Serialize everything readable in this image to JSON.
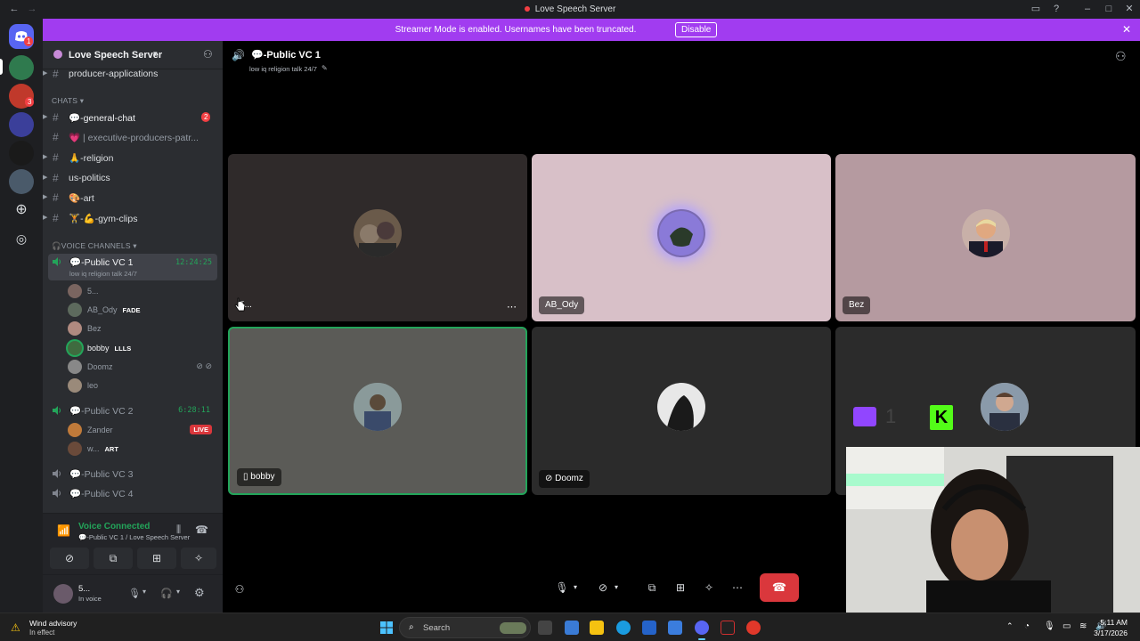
{
  "window": {
    "title": "Love Speech Server"
  },
  "banner": {
    "message": "Streamer Mode is enabled. Usernames have been truncated.",
    "button": "Disable"
  },
  "rail": {
    "badges": [
      "1",
      "3"
    ]
  },
  "sidebar": {
    "server_name": "Love Speech Server",
    "channels_top": [
      {
        "label": "producer-applications"
      }
    ],
    "chats_category": "CHATS",
    "chats": [
      {
        "label": "💬-general-chat",
        "badge": "2"
      },
      {
        "label": "💗 | executive-producers-patr..."
      },
      {
        "label": "🙏-religion"
      },
      {
        "label": "us-politics"
      },
      {
        "label": "🎨-art"
      },
      {
        "label": "🏋-💪-gym-clips"
      }
    ],
    "voice_category": "VOICE CHANNELS",
    "voice_channels": [
      {
        "label": "💬-Public VC 1",
        "timer": "12:24:25",
        "status": "low iq religion talk 24/7"
      },
      {
        "label": "💬-Public VC 2",
        "timer": "6:28:11"
      },
      {
        "label": "💬-Public VC 3"
      },
      {
        "label": "💬-Public VC 4"
      }
    ],
    "vc1_users": [
      {
        "name": "5..."
      },
      {
        "name": "AB_Ody",
        "tag": "FADE"
      },
      {
        "name": "Bez"
      },
      {
        "name": "bobby",
        "tag": "LLLS"
      },
      {
        "name": "Doomz"
      },
      {
        "name": "leo"
      }
    ],
    "vc2_users": [
      {
        "name": "Zander",
        "live": "LIVE"
      },
      {
        "name": "w...",
        "tag": "ART"
      }
    ]
  },
  "voice_panel": {
    "status": "Voice Connected",
    "location": "💬-Public VC 1 / Love Speech Server",
    "user_name": "5...",
    "user_status": "In voice"
  },
  "main": {
    "channel_name": "💬-Public VC 1",
    "channel_topic": "low iq religion talk 24/7",
    "tiles": [
      {
        "name": "5..."
      },
      {
        "name": "AB_Ody"
      },
      {
        "name": "Bez"
      },
      {
        "name": "bobby"
      },
      {
        "name": "Doomz"
      },
      {
        "name": ""
      }
    ],
    "overlay_digit": "1"
  },
  "taskbar": {
    "weather_title": "Wind advisory",
    "weather_sub": "In effect",
    "search_placeholder": "Search",
    "time": "5:11 AM",
    "date": "3/17/2026"
  },
  "colors": {
    "accent": "#a13cf0",
    "danger": "#da373c",
    "online": "#23a55a",
    "discord": "#5865f2"
  }
}
